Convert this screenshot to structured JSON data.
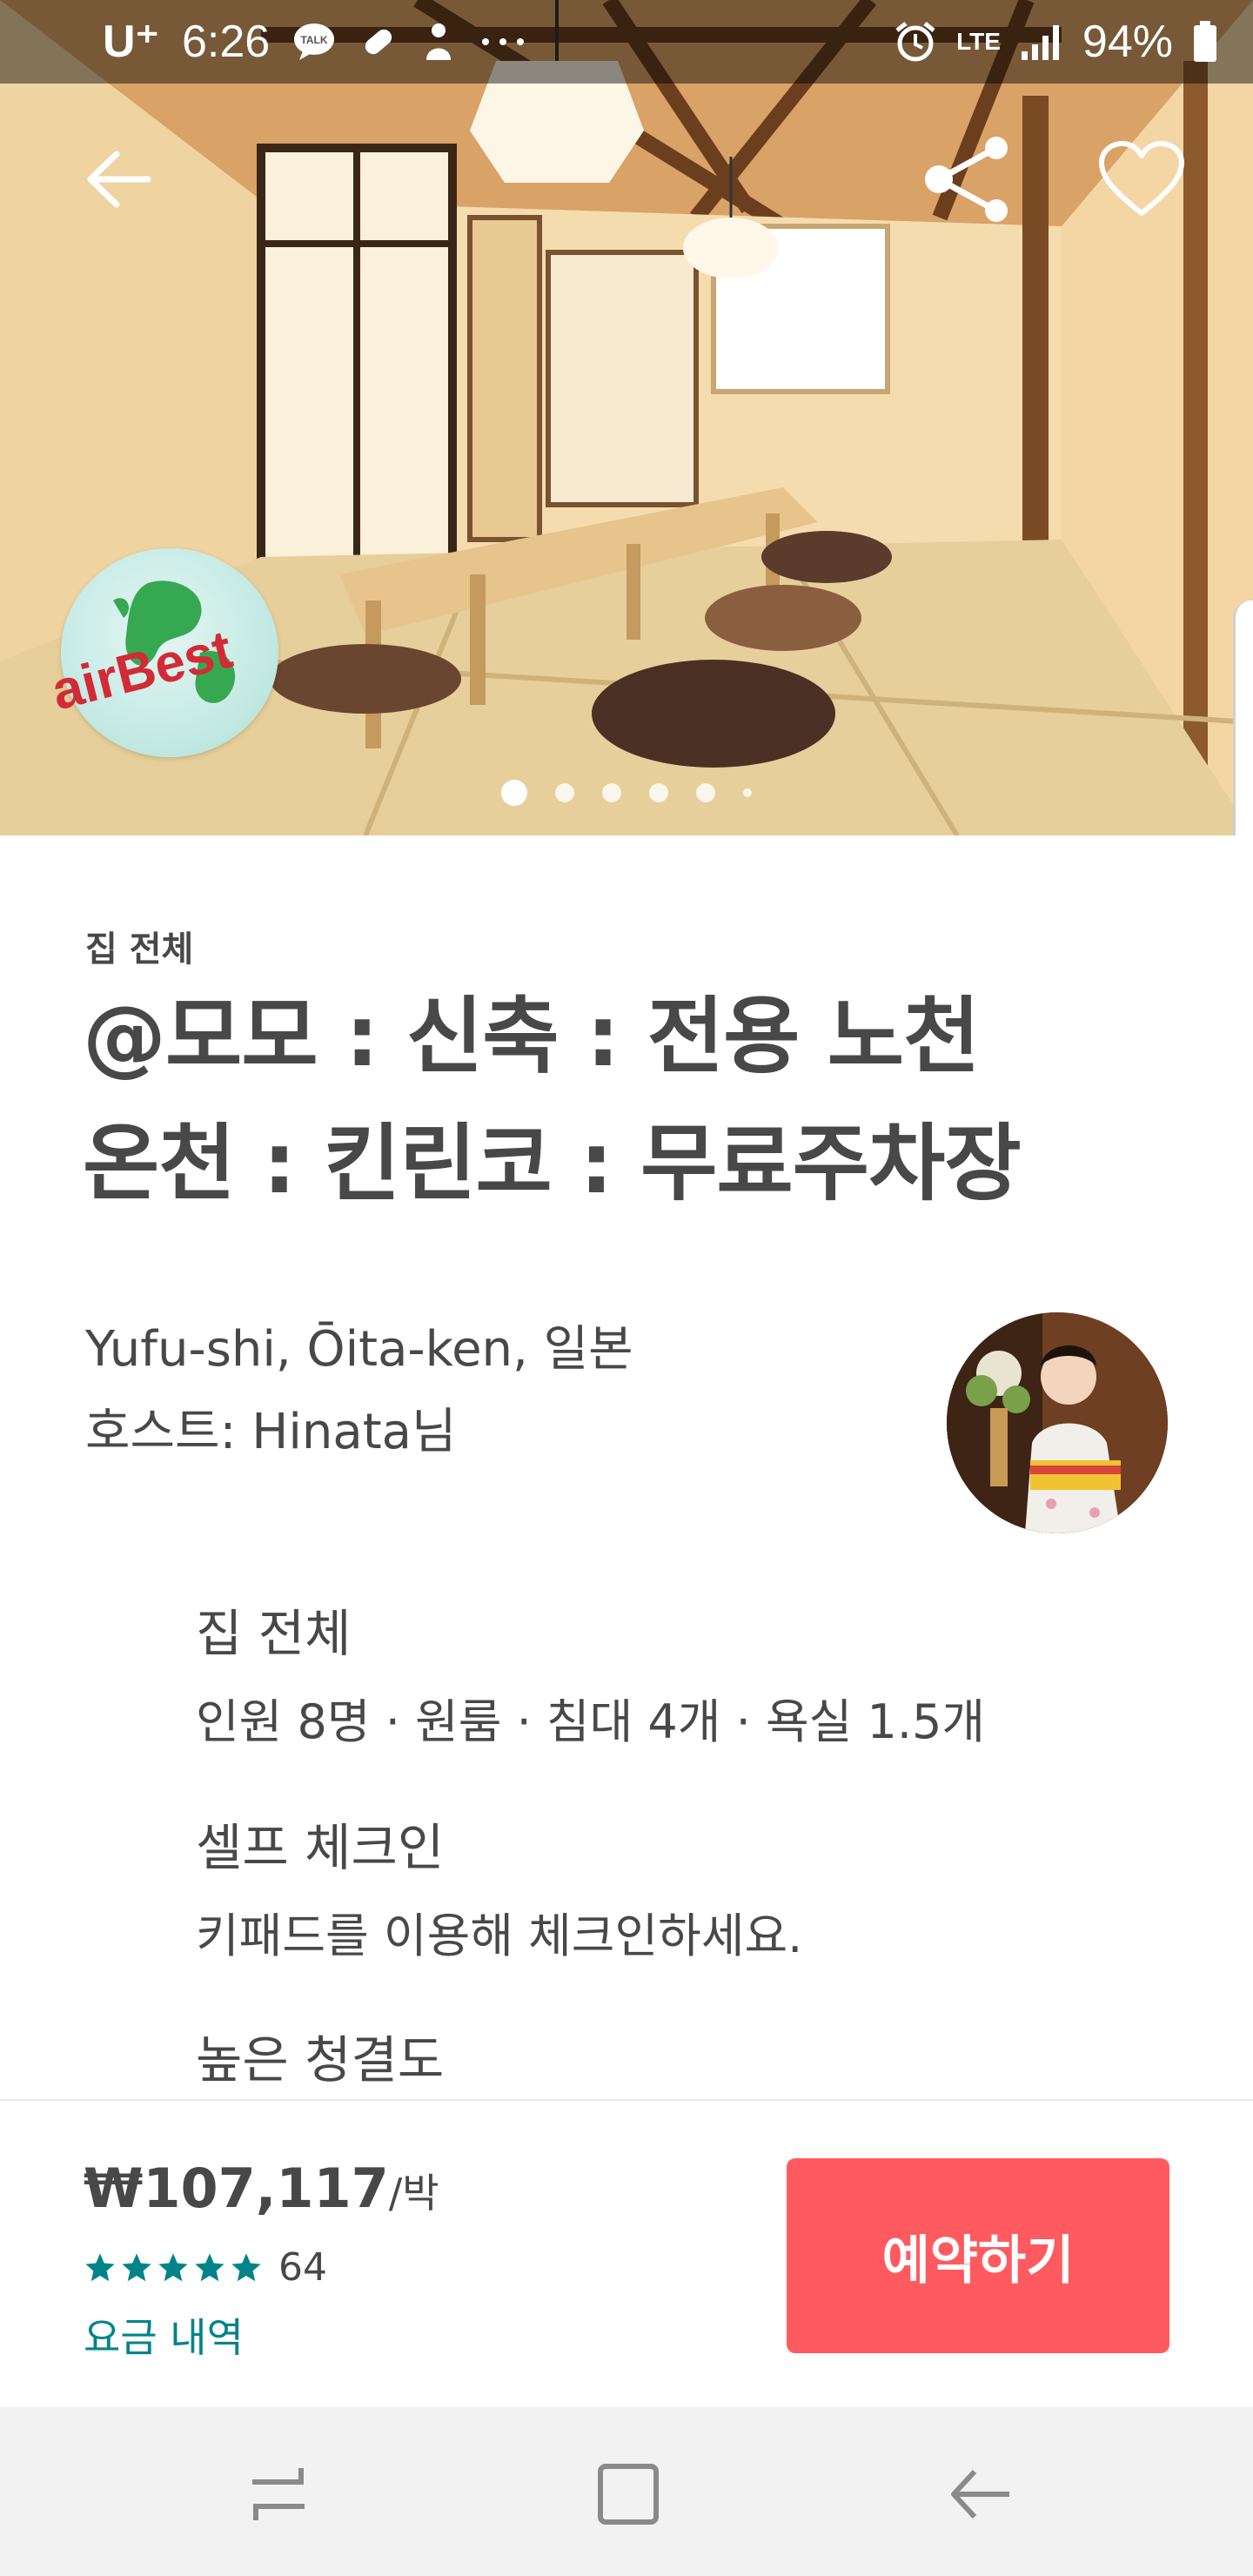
{
  "status_bar": {
    "carrier": "U⁺",
    "time": "6:26",
    "left_icons": [
      "talk-icon",
      "pill-icon",
      "person-icon",
      "more-dots-icon"
    ],
    "right_icons": [
      "alarm-icon",
      "lte-icon",
      "signal-icon",
      "battery-icon"
    ],
    "network": "LTE",
    "battery": "94%"
  },
  "hero": {
    "logo_text": "airBest",
    "photo_count": 6,
    "active_photo": 0
  },
  "listing": {
    "type_label": "집 전체",
    "title_line1": "@모모 : 신축 : 전용 노천",
    "title_line2": "온천 : 킨린코 : 무료주차장",
    "location": "Yufu-shi, Ōita-ken, 일본",
    "host": "호스트: Hinata님"
  },
  "features": [
    {
      "title": "집 전체",
      "desc": "인원 8명 · 원룸 · 침대 4개 · 욕실 1.5개"
    },
    {
      "title": "셀프 체크인",
      "desc": "키패드를 이용해 체크인하세요."
    },
    {
      "title": "높은 청결도",
      "desc": ""
    }
  ],
  "booking": {
    "price": "₩107,117",
    "price_unit": "/박",
    "rating_stars": 5,
    "review_count": "64",
    "price_detail_link": "요금 내역",
    "reserve_label": "예약하기"
  },
  "colors": {
    "accent": "#ff5a5f",
    "teal": "#008489",
    "text": "#484848",
    "star": "#008489"
  }
}
